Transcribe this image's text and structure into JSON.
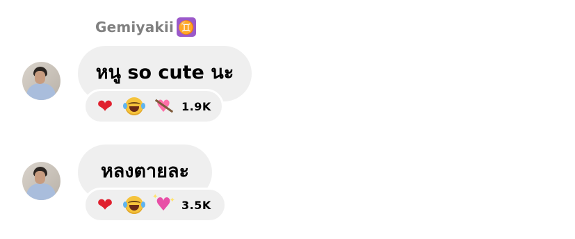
{
  "sender": {
    "name": "Gemiyakii",
    "zodiac_badge": "♊",
    "zodiac_badge_color": "#9b59c9"
  },
  "messages": [
    {
      "text": "หนู so cute นะ",
      "reactions": [
        "red-heart",
        "tears-of-joy",
        "heart-with-arrow"
      ],
      "reaction_count": "1.9K"
    },
    {
      "text": "หลงตายละ",
      "reactions": [
        "red-heart",
        "tears-of-joy",
        "sparkling-heart"
      ],
      "reaction_count": "3.5K"
    }
  ],
  "colors": {
    "bubble_background": "#efefef",
    "sender_text": "#808080"
  }
}
